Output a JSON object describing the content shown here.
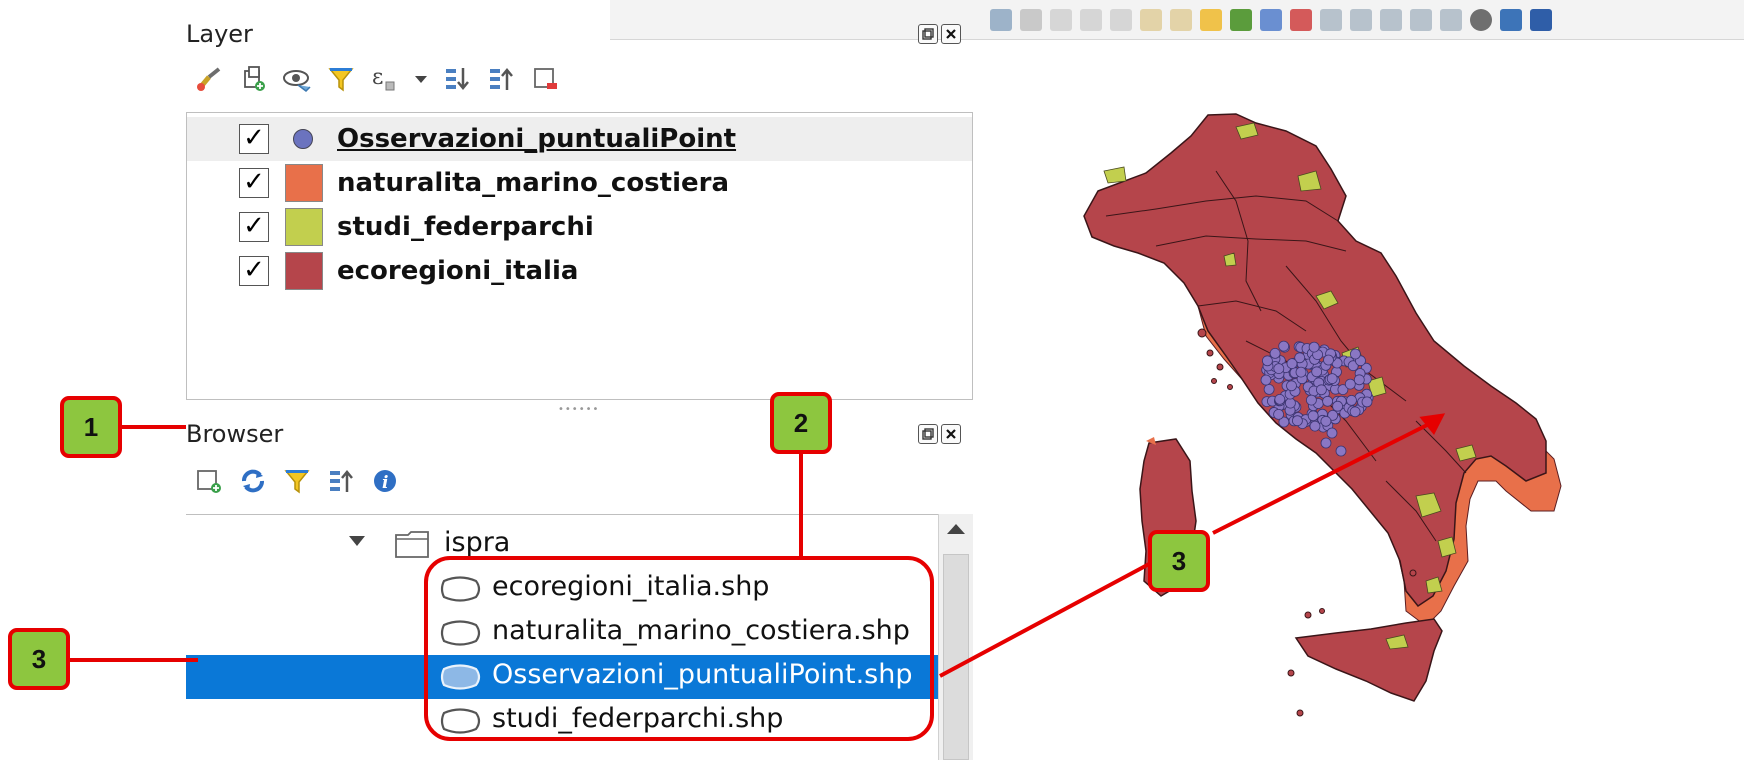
{
  "layers_panel": {
    "title": "Layer",
    "toolbar_icons": [
      "style-brush-icon",
      "add-group-icon",
      "visibility-eye-icon",
      "filter-funnel-icon",
      "expression-filter-icon",
      "dropdown-arrow-icon",
      "expand-all-icon",
      "collapse-all-icon",
      "remove-layer-icon"
    ],
    "layers": [
      {
        "name": "Osservazioni_puntualiPoint",
        "checked": true,
        "symbol": "point",
        "color": "#6b73bf"
      },
      {
        "name": "naturalita_marino_costiera",
        "checked": true,
        "symbol": "fill",
        "color": "#e8704a"
      },
      {
        "name": "studi_federparchi",
        "checked": true,
        "symbol": "fill",
        "color": "#c2cf4e"
      },
      {
        "name": "ecoregioni_italia",
        "checked": true,
        "symbol": "fill",
        "color": "#b5454b"
      }
    ],
    "check_mark": "✓"
  },
  "browser_panel": {
    "title": "Browser",
    "toolbar_icons": [
      "add-layer-icon",
      "refresh-icon",
      "filter-funnel-icon",
      "collapse-all-icon",
      "properties-info-icon"
    ],
    "folder": "ispra",
    "files": [
      {
        "name": "ecoregioni_italia.shp",
        "selected": false
      },
      {
        "name": "naturalita_marino_costiera.shp",
        "selected": false
      },
      {
        "name": "Osservazioni_puntualiPoint.shp",
        "selected": true
      },
      {
        "name": "studi_federparchi.shp",
        "selected": false
      }
    ]
  },
  "callouts": {
    "one": "1",
    "two": "2",
    "three_left": "3",
    "three_map": "3"
  },
  "colors": {
    "accent_red": "#e60000",
    "callout_green": "#8dc63f",
    "selection_blue": "#0a78d7",
    "ecoregioni": "#b5454b",
    "naturalita": "#e8704a",
    "federparchi": "#c2cf4e",
    "points": "#8a77c4"
  }
}
